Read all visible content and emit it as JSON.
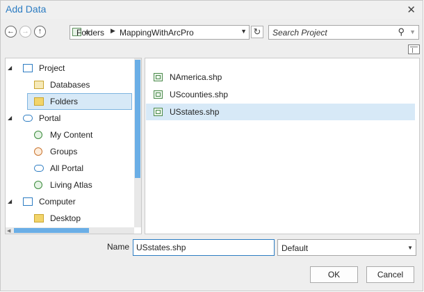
{
  "dialog": {
    "title": "Add Data",
    "close_glyph": "✕"
  },
  "nav": {
    "back_glyph": "←",
    "forward_glyph": "→",
    "up_glyph": "↑"
  },
  "path": {
    "chevron": "«",
    "segments": [
      "Folders",
      "MappingWithArcPro"
    ],
    "separator": "▶",
    "dropdown_glyph": "▼"
  },
  "refresh_glyph": "↻",
  "search": {
    "placeholder": "Search Project",
    "icon_glyph": "⚲",
    "dropdown_glyph": "▼"
  },
  "tree": {
    "expanded_glyph": "◢",
    "items": [
      {
        "label": "Project",
        "icon": "project-icon",
        "level": 0
      },
      {
        "label": "Databases",
        "icon": "database-folder-icon",
        "level": 1
      },
      {
        "label": "Folders",
        "icon": "folder-icon",
        "level": 1,
        "selected": true
      },
      {
        "label": "Portal",
        "icon": "cloud-icon",
        "level": 0
      },
      {
        "label": "My Content",
        "icon": "my-content-icon",
        "level": 1
      },
      {
        "label": "Groups",
        "icon": "groups-icon",
        "level": 1
      },
      {
        "label": "All Portal",
        "icon": "cloud-icon",
        "level": 1
      },
      {
        "label": "Living Atlas",
        "icon": "living-atlas-icon",
        "level": 1
      },
      {
        "label": "Computer",
        "icon": "computer-icon",
        "level": 0
      },
      {
        "label": "Desktop",
        "icon": "folder-icon",
        "level": 1
      }
    ]
  },
  "files": [
    {
      "name": "NAmerica.shp",
      "icon": "shapefile-icon"
    },
    {
      "name": "UScounties.shp",
      "icon": "shapefile-icon"
    },
    {
      "name": "USstates.shp",
      "icon": "shapefile-icon",
      "selected": true
    }
  ],
  "footer": {
    "name_label": "Name",
    "name_value": "USstates.shp",
    "filter_value": "Default",
    "filter_dropdown_glyph": "▼",
    "ok_label": "OK",
    "cancel_label": "Cancel"
  },
  "colors": {
    "accent": "#2c7cc2",
    "selection": "#d7e9f7",
    "scroll_thumb": "#6aaee6"
  }
}
